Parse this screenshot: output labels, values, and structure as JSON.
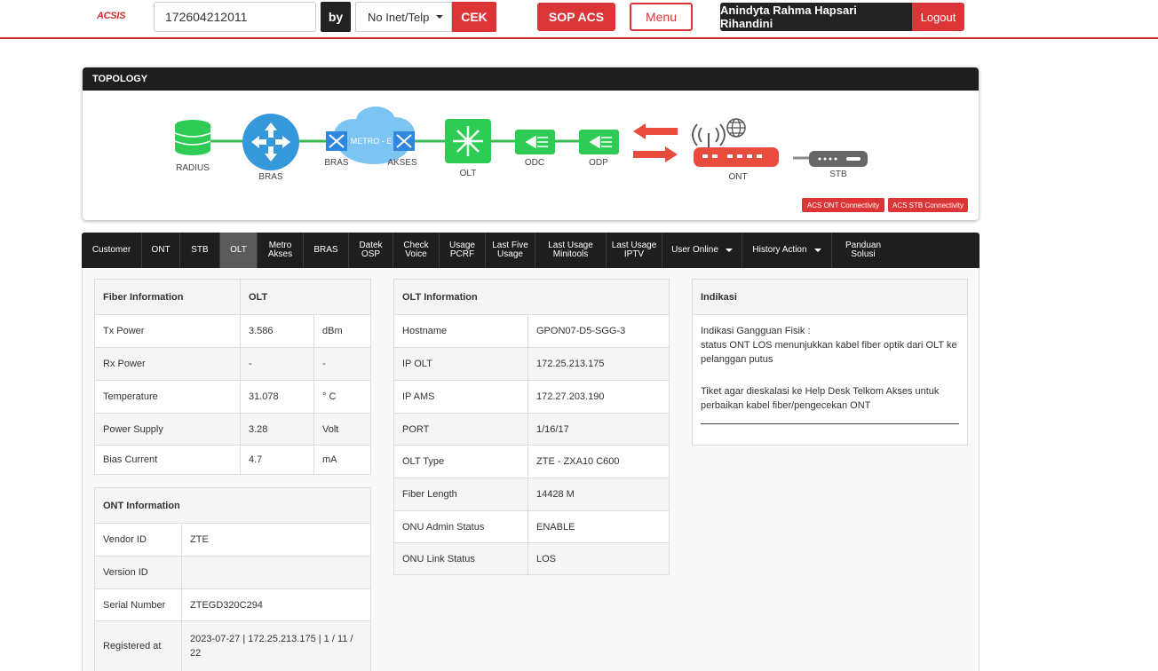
{
  "header": {
    "logo": "ACSIS",
    "search_value": "172604212011",
    "by_label": "by",
    "type_selected": "No Inet/Telp",
    "cek_label": "CEK",
    "sop_label": "SOP ACS",
    "menu_label": "Menu",
    "user_name": "Anindyta Rahma Hapsari Rihandini",
    "logout_label": "Logout"
  },
  "topology": {
    "title": "TOPOLOGY",
    "nodes": {
      "radius": "RADIUS",
      "bras": "BRAS",
      "metro_bras": "BRAS",
      "metro": "METRO - E",
      "akses": "AKSES",
      "olt": "OLT",
      "odc": "ODC",
      "odp": "ODP",
      "ont": "ONT",
      "stb": "STB"
    },
    "acs_ont_label": "ACS ONT Connectivity",
    "acs_stb_label": "ACS STB Connectivity",
    "colors": {
      "link": "#3cba54",
      "node_green": "#2ecc55",
      "node_blue": "#3498db",
      "arrow_red": "#e74c3c"
    }
  },
  "tabs": [
    {
      "label": "Customer"
    },
    {
      "label": "ONT"
    },
    {
      "label": "STB"
    },
    {
      "label": "OLT",
      "active": true
    },
    {
      "label": "Metro Akses"
    },
    {
      "label": "BRAS"
    },
    {
      "label": "Datek OSP"
    },
    {
      "label": "Check Voice"
    },
    {
      "label": "Usage PCRF"
    },
    {
      "label": "Last Five Usage"
    },
    {
      "label": "Last Usage Minitools"
    },
    {
      "label": "Last Usage IPTV"
    },
    {
      "label": "User Online",
      "dropdown": true
    },
    {
      "label": "History Action",
      "dropdown": true
    },
    {
      "label": "Panduan Solusi"
    }
  ],
  "fiber": {
    "title": "Fiber Information",
    "col2": "OLT",
    "rows": [
      {
        "label": "Tx Power",
        "value": "3.586",
        "unit": "dBm"
      },
      {
        "label": "Rx Power",
        "value": "-",
        "unit": "-"
      },
      {
        "label": "Temperature",
        "value": "31.078",
        "unit": "° C"
      },
      {
        "label": "Power Supply",
        "value": "3.28",
        "unit": "Volt"
      },
      {
        "label": "Bias Current",
        "value": "4.7",
        "unit": "mA"
      }
    ]
  },
  "ont": {
    "title": "ONT Information",
    "rows": [
      {
        "label": "Vendor ID",
        "value": "ZTE"
      },
      {
        "label": "Version ID",
        "value": ""
      },
      {
        "label": "Serial Number",
        "value": "ZTEGD320C294"
      },
      {
        "label": "Registered at",
        "value": "2023-07-27 | 172.25.213.175 | 1 / 11 / 22"
      }
    ]
  },
  "olt": {
    "title": "OLT Information",
    "rows": [
      {
        "label": "Hostname",
        "value": "GPON07-D5-SGG-3"
      },
      {
        "label": "IP OLT",
        "value": "172.25.213.175"
      },
      {
        "label": "IP AMS",
        "value": "172.27.203.190"
      },
      {
        "label": "PORT",
        "value": "1/16/17"
      },
      {
        "label": "OLT Type",
        "value": "ZTE - ZXA10 C600"
      },
      {
        "label": "Fiber Length",
        "value": "14428 M"
      },
      {
        "label": "ONU Admin Status",
        "value": "ENABLE"
      },
      {
        "label": "ONU Link Status",
        "value": "LOS"
      }
    ]
  },
  "indikasi": {
    "title": "Indikasi",
    "line1": "Indikasi Gangguan Fisik :",
    "line2": "status ONT LOS menunjukkan kabel fiber optik dari OLT ke pelanggan putus",
    "line3": "Tiket agar dieskalasi ke Help Desk Telkom Akses untuk perbaikan kabel fiber/pengecekan ONT"
  }
}
